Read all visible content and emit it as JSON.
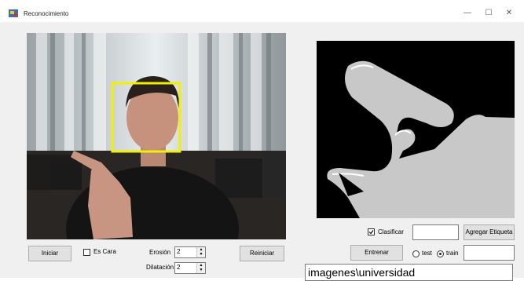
{
  "window": {
    "title": "Reconocimiento"
  },
  "controls": {
    "iniciar_label": "Iniciar",
    "es_cara_label": "Es Cara",
    "erosion_label": "Erosión",
    "erosion_value": "2",
    "dilatacion_label": "Dilatación",
    "dilatacion_value": "2",
    "reiniciar_label": "Reiniciar",
    "clasificar_label": "Clasificar",
    "agregar_etiqueta_label": "Agregar Etiqueta",
    "entrenar_label": "Entrenar",
    "test_label": "test",
    "train_label": "train",
    "path_value": "imagenes\\universidad"
  }
}
